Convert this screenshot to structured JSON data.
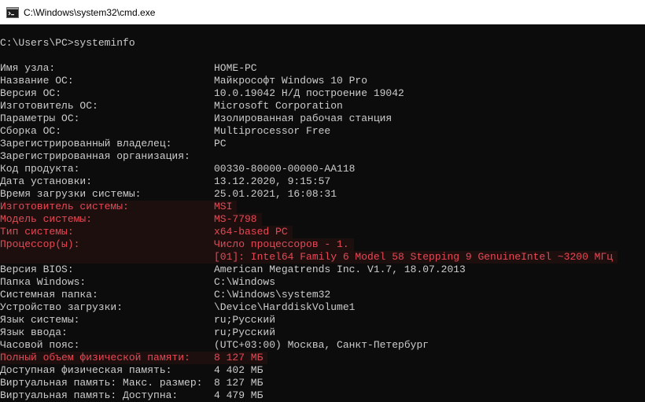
{
  "window": {
    "title": "C:\\Windows\\system32\\cmd.exe",
    "icon": "cmd-icon"
  },
  "console": {
    "prompt": "C:\\Users\\PC>systeminfo",
    "rows": [
      {
        "label": "Имя узла:",
        "value": "HOME-PC"
      },
      {
        "label": "Название ОС:",
        "value": "Майкрософт Windows 10 Pro"
      },
      {
        "label": "Версия ОС:",
        "value": "10.0.19042 Н/Д построение 19042"
      },
      {
        "label": "Изготовитель ОС:",
        "value": "Microsoft Corporation"
      },
      {
        "label": "Параметры ОС:",
        "value": "Изолированная рабочая станция"
      },
      {
        "label": "Сборка ОС:",
        "value": "Multiprocessor Free"
      },
      {
        "label": "Зарегистрированный владелец:",
        "value": "PC"
      },
      {
        "label": "Зарегистрированная организация:",
        "value": ""
      },
      {
        "label": "Код продукта:",
        "value": "00330-80000-00000-AA118"
      },
      {
        "label": "Дата установки:",
        "value": "13.12.2020, 9:15:57"
      },
      {
        "label": "Время загрузки системы:",
        "value": "25.01.2021, 16:08:31"
      },
      {
        "label": "Изготовитель системы:",
        "value": "MSI",
        "highlight": true
      },
      {
        "label": "Модель системы:",
        "value": "MS-7798",
        "highlight": true
      },
      {
        "label": "Тип системы:",
        "value": "x64-based PC",
        "highlight": true
      },
      {
        "label": "Процессор(ы):",
        "value": "Число процессоров - 1.",
        "highlight": true
      },
      {
        "label": "",
        "value": "[01]: Intel64 Family 6 Model 58 Stepping 9 GenuineIntel ~3200 МГц",
        "highlight": true
      },
      {
        "label": "Версия BIOS:",
        "value": "American Megatrends Inc. V1.7, 18.07.2013"
      },
      {
        "label": "Папка Windows:",
        "value": "C:\\Windows"
      },
      {
        "label": "Системная папка:",
        "value": "C:\\Windows\\system32"
      },
      {
        "label": "Устройство загрузки:",
        "value": "\\Device\\HarddiskVolume1"
      },
      {
        "label": "Язык системы:",
        "value": "ru;Русский"
      },
      {
        "label": "Язык ввода:",
        "value": "ru;Русский"
      },
      {
        "label": "Часовой пояс:",
        "value": "(UTC+03:00) Москва, Санкт-Петербург"
      },
      {
        "label": "Полный объем физической памяти:",
        "value": "8 127 МБ",
        "highlight": true
      },
      {
        "label": "Доступная физическая память:",
        "value": "4 402 МБ"
      },
      {
        "label": "Виртуальная память: Макс. размер:",
        "value": "8 127 МБ"
      },
      {
        "label": "Виртуальная память: Доступна:",
        "value": "4 479 МБ"
      }
    ]
  }
}
